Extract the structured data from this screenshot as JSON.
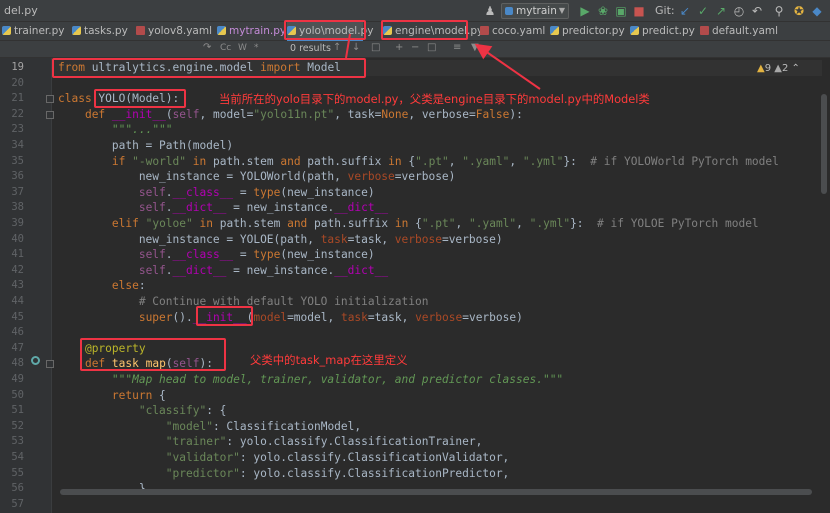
{
  "window": {
    "file_label": "del.py"
  },
  "toolbar": {
    "run_config": "mytrain",
    "git_label": "Git:"
  },
  "tabs": [
    {
      "label": "trainer.py",
      "icon": "python-file-icon"
    },
    {
      "label": "tasks.py",
      "icon": "python-file-icon"
    },
    {
      "label": "yolov8.yaml",
      "icon": "yaml-file-icon"
    },
    {
      "label": "mytrain.py",
      "icon": "python-file-icon"
    },
    {
      "label": "yolo\\model.py",
      "icon": "python-file-icon",
      "active": true
    },
    {
      "label": "engine\\model.py",
      "icon": "python-file-icon"
    },
    {
      "label": "coco.yaml",
      "icon": "yaml-file-icon"
    },
    {
      "label": "predictor.py",
      "icon": "python-file-icon"
    },
    {
      "label": "predict.py",
      "icon": "python-file-icon"
    },
    {
      "label": "default.yaml",
      "icon": "yaml-file-icon"
    }
  ],
  "findbar": {
    "match_case": "Cc",
    "whole_word": "W",
    "regex": "*",
    "results": "0 results"
  },
  "inspections": {
    "warnings": "9",
    "weak_warnings": "2"
  },
  "line_numbers": [
    "19",
    "20",
    "21",
    "22",
    "23",
    "34",
    "35",
    "36",
    "37",
    "38",
    "39",
    "40",
    "41",
    "42",
    "43",
    "44",
    "45",
    "46",
    "47",
    "48",
    "49",
    "50",
    "51",
    "52",
    "53",
    "54",
    "55",
    "56",
    "57"
  ],
  "current_line": "19",
  "annotations": {
    "class_note": "当前所在的yolo目录下的model.py，父类是engine目录下的model.py中的Model类",
    "task_map_note": "父类中的task_map在这里定义"
  },
  "colors": {
    "annotation_red": "#ee3344",
    "editor_bg": "#2b2b2b",
    "keyword": "#cc7832",
    "string": "#6a8759",
    "function": "#ffc66d"
  }
}
